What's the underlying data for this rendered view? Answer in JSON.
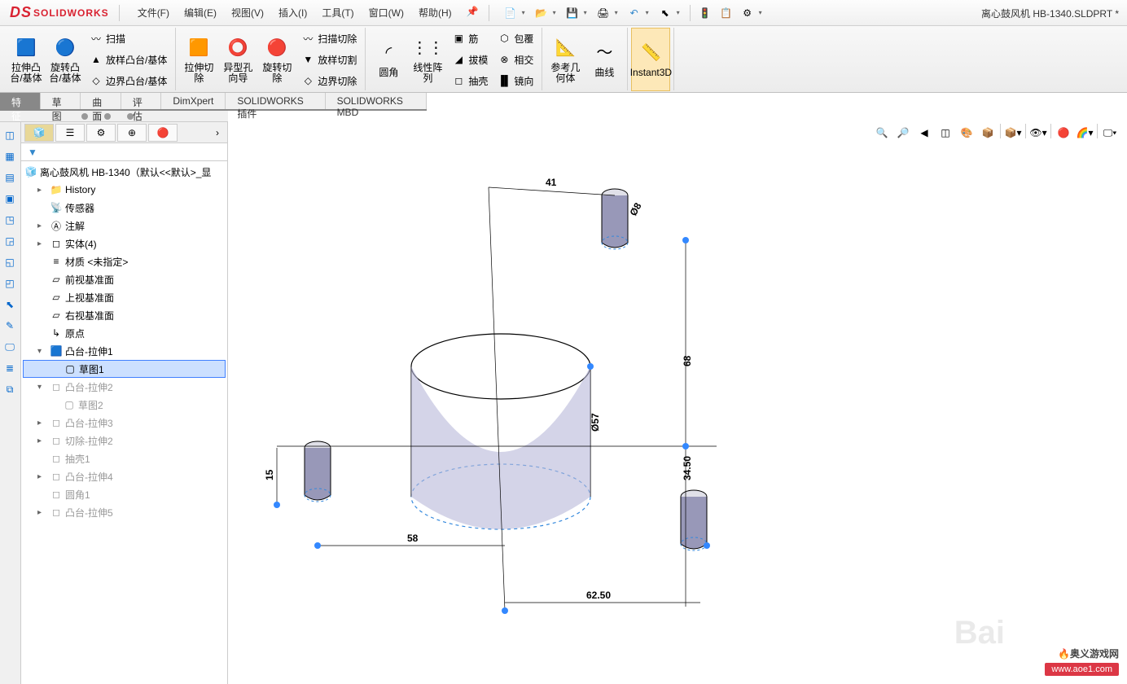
{
  "app": {
    "name": "SOLIDWORKS",
    "doc_title": "离心鼓风机 HB-1340.SLDPRT *"
  },
  "menu": {
    "file": "文件(F)",
    "edit": "编辑(E)",
    "view": "视图(V)",
    "insert": "插入(I)",
    "tools": "工具(T)",
    "window": "窗口(W)",
    "help": "帮助(H)"
  },
  "ribbon": {
    "extrude_boss": "拉伸凸台/基体",
    "revolve_boss": "旋转凸台/基体",
    "sweep": "扫描",
    "loft_boss": "放样凸台/基体",
    "boundary_boss": "边界凸台/基体",
    "extrude_cut": "拉伸切除",
    "hole_wizard": "异型孔向导",
    "revolve_cut": "旋转切除",
    "sweep_cut": "扫描切除",
    "loft_cut": "放样切割",
    "boundary_cut": "边界切除",
    "fillet": "圆角",
    "linear_pattern": "线性阵列",
    "rib": "筋",
    "draft": "拔模",
    "shell": "抽壳",
    "wrap": "包覆",
    "intersect": "相交",
    "mirror": "镜向",
    "ref_geom": "参考几何体",
    "curves": "曲线",
    "instant3d": "Instant3D"
  },
  "tabs": {
    "features": "特征",
    "sketch": "草图",
    "surfaces": "曲面",
    "evaluate": "评估",
    "dimxpert": "DimXpert",
    "plugins": "SOLIDWORKS 插件",
    "mbd": "SOLIDWORKS MBD"
  },
  "tree": {
    "root": "离心鼓风机 HB-1340（默认<<默认>_显",
    "history": "History",
    "sensors": "传感器",
    "annotations": "注解",
    "solid_bodies": "实体(4)",
    "material": "材质 <未指定>",
    "front_plane": "前视基准面",
    "top_plane": "上视基准面",
    "right_plane": "右视基准面",
    "origin": "原点",
    "extrude1": "凸台-拉伸1",
    "sketch1": "草图1",
    "extrude2": "凸台-拉伸2",
    "sketch2": "草图2",
    "extrude3": "凸台-拉伸3",
    "cut2": "切除-拉伸2",
    "shell1": "抽壳1",
    "extrude4": "凸台-拉伸4",
    "fillet1": "圆角1",
    "extrude5": "凸台-拉伸5"
  },
  "dims": {
    "d41": "41",
    "d8": "Ø8",
    "d57": "Ø57",
    "d58": "58",
    "d68": "68",
    "d15": "15",
    "d34_5": "34.50",
    "d62_5": "62.50"
  },
  "watermark": {
    "name": "奥义游戏网",
    "url": "www.aoe1.com"
  }
}
